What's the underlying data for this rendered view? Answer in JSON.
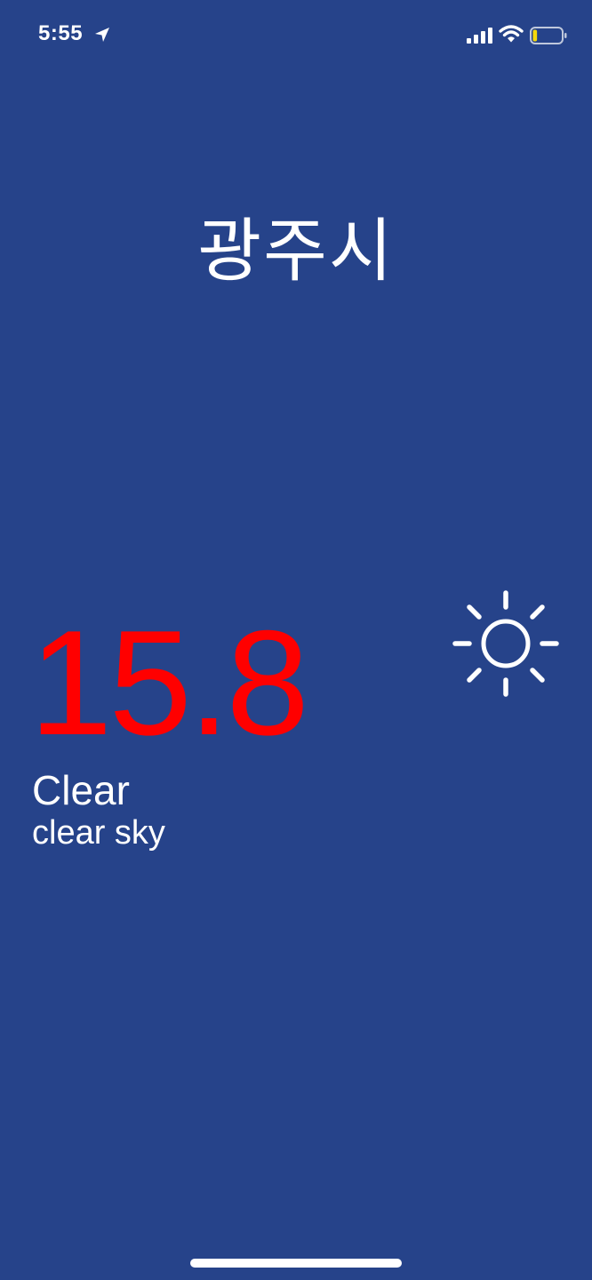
{
  "status_bar": {
    "time": "5:55",
    "battery_level": 0.15,
    "battery_color": "#F5D90A"
  },
  "weather": {
    "city": "광주시",
    "temperature": "15.8",
    "condition": "Clear",
    "description": "clear sky",
    "icon": "sun-icon"
  },
  "colors": {
    "background": "#26438A",
    "temperature": "#FF0000",
    "text": "#FFFFFF"
  }
}
